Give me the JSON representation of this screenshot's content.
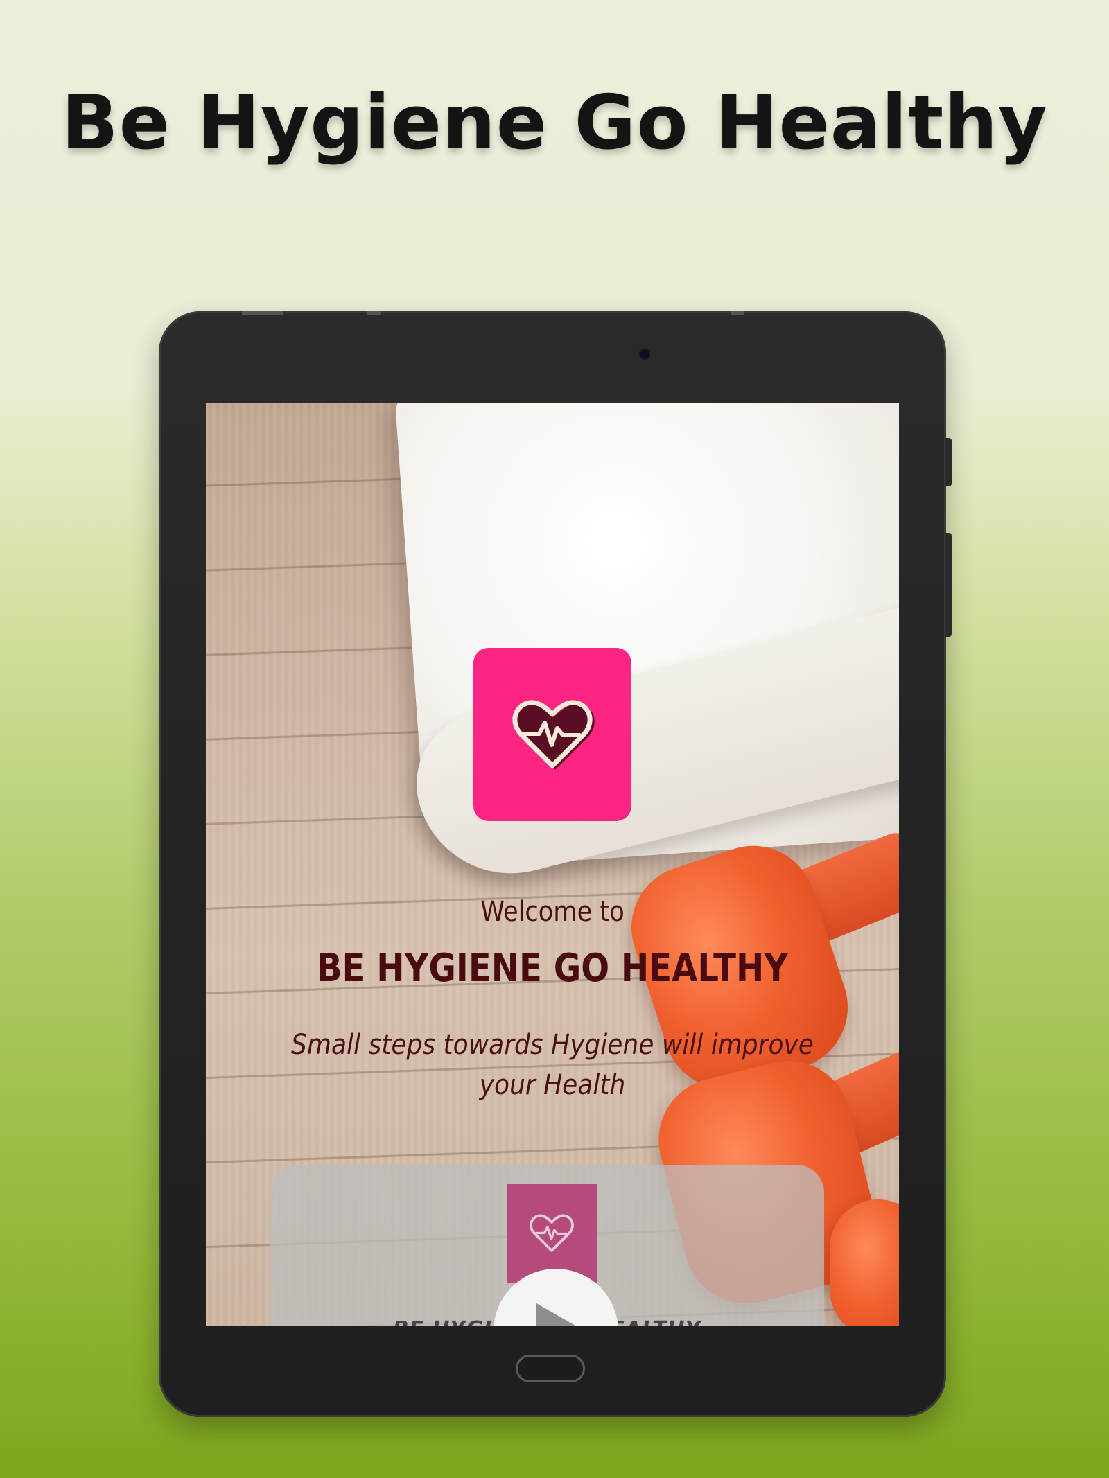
{
  "promo": {
    "headline": "Be Hygiene Go Healthy"
  },
  "colors": {
    "background_top": "#ebefdc",
    "background_bottom": "#7da71d",
    "device_bezel": "#252525",
    "icon_pink": "#fd2583",
    "text_maroon": "#4a0b10"
  },
  "app_screen": {
    "icon": "heart-pulse-icon",
    "welcome": "Welcome to",
    "app_name": "BE HYGIENE GO HEALTHY",
    "tagline": "Small steps towards Hygiene will improve your Health",
    "video_card": {
      "icon": "heart-pulse-icon",
      "play_icon": "play-icon",
      "title": "BE HYGIENE GO HEALTHY"
    }
  }
}
